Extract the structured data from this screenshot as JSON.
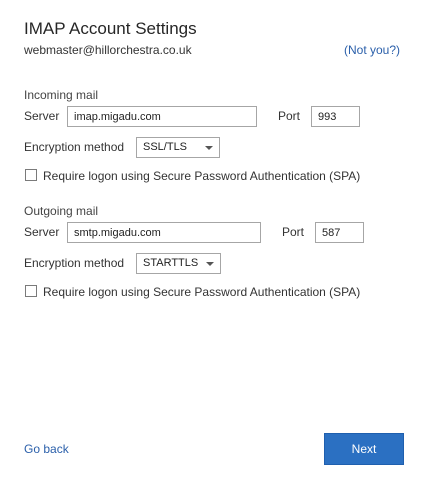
{
  "header": {
    "title": "IMAP Account Settings",
    "email": "webmaster@hillorchestra.co.uk",
    "not_you_link": "(Not you?)"
  },
  "incoming": {
    "section_label": "Incoming mail",
    "server_label": "Server",
    "server_value": "imap.migadu.com",
    "port_label": "Port",
    "port_value": "993",
    "encryption_label": "Encryption method",
    "encryption_value": "SSL/TLS",
    "spa_label": "Require logon using Secure Password Authentication (SPA)",
    "spa_checked": false
  },
  "outgoing": {
    "section_label": "Outgoing mail",
    "server_label": "Server",
    "server_value": "smtp.migadu.com",
    "port_label": "Port",
    "port_value": "587",
    "encryption_label": "Encryption method",
    "encryption_value": "STARTTLS",
    "spa_label": "Require logon using Secure Password Authentication (SPA)",
    "spa_checked": false
  },
  "footer": {
    "go_back_label": "Go back",
    "next_label": "Next"
  },
  "colors": {
    "accent": "#2b70c2",
    "link": "#2a5faa"
  }
}
